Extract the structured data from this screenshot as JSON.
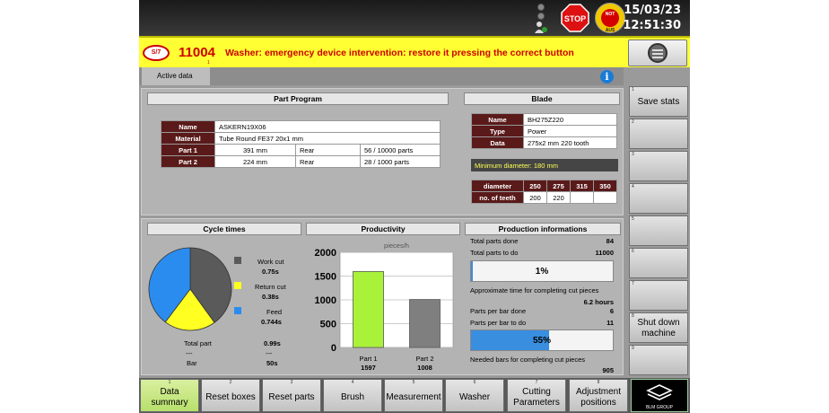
{
  "topbar": {
    "date": "15/03/23",
    "time": "12:51:30",
    "stop_label": "STOP",
    "notaus_top": "NOT",
    "notaus_bottom": "AUS"
  },
  "alarm": {
    "logo_text": "S/7",
    "code": "11004",
    "code_sub": "1",
    "message": "Washer: emergency device intervention: restore it pressing the correct button"
  },
  "tabs": {
    "active": "Active data",
    "info": "i"
  },
  "part_program": {
    "header": "Part Program",
    "rows": [
      {
        "label": "Name",
        "cells": [
          "ASKERN19X06"
        ]
      },
      {
        "label": "Material",
        "cells": [
          "Tube  Round  FE37   20x1 mm"
        ]
      },
      {
        "label": "Part 1",
        "cells": [
          "391 mm",
          "Rear",
          "56 / 10000 parts"
        ]
      },
      {
        "label": "Part 2",
        "cells": [
          "224 mm",
          "Rear",
          "28 / 1000 parts"
        ]
      }
    ]
  },
  "blade": {
    "header": "Blade",
    "rows": [
      {
        "label": "Name",
        "value": "BH275Z220"
      },
      {
        "label": "Type",
        "value": "Power"
      },
      {
        "label": "Data",
        "value": "275x2 mm   220 tooth"
      }
    ],
    "min_diameter": "Minimum diameter: 180 mm",
    "diam_label": "diameter",
    "teeth_label": "no. of teeth",
    "diameters": [
      "250",
      "275",
      "315",
      "350"
    ],
    "teeth": [
      "200",
      "220",
      "",
      ""
    ]
  },
  "cycle_times": {
    "header": "Cycle times",
    "slices": [
      {
        "label": "Work cut",
        "value": "0.75s",
        "num": 0.75,
        "color": "#5a5a5a"
      },
      {
        "label": "Return cut",
        "value": "0.38s",
        "num": 0.38,
        "color": "#ffff22"
      },
      {
        "label": "Feed",
        "value": "0.744s",
        "num": 0.744,
        "color": "#2b8cf0"
      }
    ],
    "total_label": "Total part",
    "total_value": "0.99s",
    "dash1": "---",
    "dash2": "---",
    "bar_label": "Bar",
    "bar_value": "50s"
  },
  "productivity": {
    "header": "Productivity",
    "unit": "pieces/h"
  },
  "chart_data": {
    "type": "bar",
    "categories": [
      "Part 1",
      "Part 2"
    ],
    "values": [
      1597,
      1008
    ],
    "value_labels": [
      "1597",
      "1008"
    ],
    "colors": [
      "#aaf23a",
      "#7f7f7f"
    ],
    "ylabel": "pieces/h",
    "ylim": [
      0,
      2000
    ],
    "yticks": [
      "0",
      "500",
      "1000",
      "1500",
      "2000"
    ],
    "grid": true
  },
  "production": {
    "header": "Production informations",
    "total_done_label": "Total parts done",
    "total_done": "84",
    "total_todo_label": "Total parts to do",
    "total_todo": "11000",
    "progress1": 1,
    "progress1_text": "1%",
    "approx_label": "Approximate time for completing cut pieces",
    "approx_value": "6.2 hours",
    "per_bar_done_label": "Parts per bar done",
    "per_bar_done": "6",
    "per_bar_todo_label": "Parts per bar to do",
    "per_bar_todo": "11",
    "progress2": 55,
    "progress2_text": "55%",
    "needed_label": "Needed bars for completing cut pieces",
    "needed_value": "905"
  },
  "side_buttons": [
    {
      "num": "1",
      "label": "Save stats"
    },
    {
      "num": "2",
      "label": ""
    },
    {
      "num": "3",
      "label": ""
    },
    {
      "num": "4",
      "label": ""
    },
    {
      "num": "5",
      "label": ""
    },
    {
      "num": "6",
      "label": ""
    },
    {
      "num": "7",
      "label": ""
    },
    {
      "num": "8",
      "label": "Shut down machine"
    },
    {
      "num": "9",
      "label": ""
    }
  ],
  "nav_buttons": [
    {
      "num": "1",
      "label": "Data summary"
    },
    {
      "num": "2",
      "label": "Reset boxes"
    },
    {
      "num": "3",
      "label": "Reset parts"
    },
    {
      "num": "4",
      "label": "Brush"
    },
    {
      "num": "5",
      "label": "Measurement"
    },
    {
      "num": "6",
      "label": "Washer"
    },
    {
      "num": "7",
      "label": "Cutting Parameters"
    },
    {
      "num": "8",
      "label": "Adjustment positions"
    }
  ],
  "brand": {
    "logo_text": "BLM GROUP"
  }
}
